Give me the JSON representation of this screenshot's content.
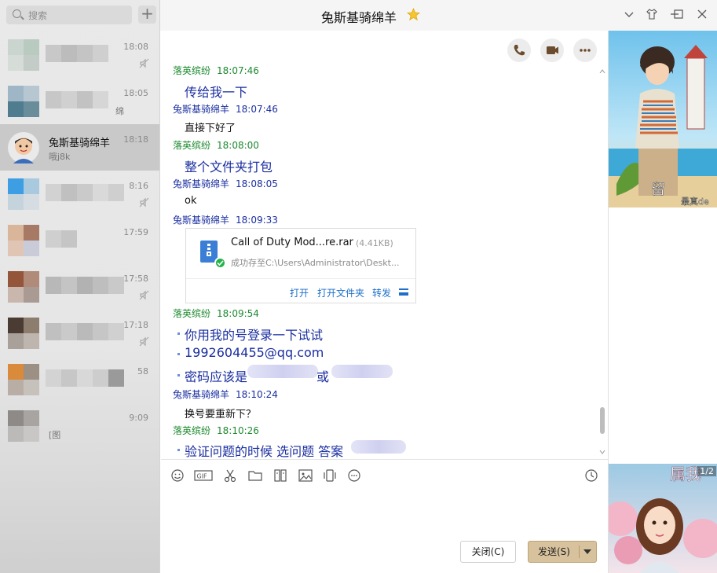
{
  "sidebar": {
    "search_placeholder": "搜索",
    "add_label": "+",
    "contacts": [
      {
        "time": "18:08"
      },
      {
        "time": "18:05",
        "preview": "绵"
      },
      {
        "name": "兔斯基骑绵羊",
        "time": "18:18",
        "preview": "哦j8k",
        "active": true
      },
      {
        "time": "8:16"
      },
      {
        "time": "17:59"
      },
      {
        "time": "17:58"
      },
      {
        "time": "17:18"
      },
      {
        "time": "58"
      },
      {
        "time": "9:09",
        "preview": "[图"
      }
    ]
  },
  "header": {
    "title": "兔斯基骑绵羊",
    "window_buttons": [
      "chevron-down-icon",
      "shirt-icon",
      "minimize-icon",
      "maximize-icon",
      "close-icon"
    ]
  },
  "call_buttons": [
    "phone-icon",
    "video-icon",
    "more-icon"
  ],
  "messages": [
    {
      "sender": "落英缤纷",
      "time": "18:07:46",
      "color": "green",
      "text": "传给我一下",
      "style": "big"
    },
    {
      "sender": "兔斯基骑绵羊",
      "time": "18:07:46",
      "color": "blue",
      "text": "直接下好了",
      "style": "normal"
    },
    {
      "sender": "落英缤纷",
      "time": "18:08:00",
      "color": "green",
      "text": "整个文件夹打包",
      "style": "big"
    },
    {
      "sender": "兔斯基骑绵羊",
      "time": "18:08:05",
      "color": "blue",
      "text": "ok",
      "style": "normal"
    },
    {
      "sender": "兔斯基骑绵羊",
      "time": "18:09:33",
      "color": "blue"
    },
    {
      "sender": "落英缤纷",
      "time": "18:09:54",
      "color": "green"
    },
    {
      "sender": "兔斯基骑绵羊",
      "time": "18:10:24",
      "color": "blue",
      "text": "换号要重新下？",
      "style": "normal"
    },
    {
      "sender": "落英缤纷",
      "time": "18:10:26",
      "color": "green"
    }
  ],
  "multi_lines": {
    "m6_line1": "你用我的号登录一下试试",
    "m6_line2": "1992604455@qq.com",
    "m6_line3a": "密码应该是",
    "m6_line3b": "或",
    "m8_line1": "验证问题的时候 选问题  答案"
  },
  "file_card": {
    "name": "Call of Duty Mod...re.rar",
    "size": "(4.41KB)",
    "status": "成功存至C:\\Users\\Administrator\\Deskt...",
    "actions": [
      "打开",
      "打开文件夹",
      "转发"
    ]
  },
  "toolbar": [
    "emoji-icon",
    "gif-icon",
    "scissors-icon",
    "folder-icon",
    "doc-icon",
    "image-icon",
    "shake-icon",
    "more-circle-icon",
    "history-icon"
  ],
  "buttons": {
    "close_label": "关闭(C)",
    "send_label": "发送(S)"
  },
  "ads": {
    "top_text_1": "留",
    "top_text_2": "最真de",
    "bottom_counter": "1/2",
    "bottom_text": "属我"
  },
  "colors": {
    "green_name": "#1d8a2f",
    "blue_name": "#1a2ea0",
    "link": "#1d6fc8",
    "send_button": "#d8c29d"
  }
}
